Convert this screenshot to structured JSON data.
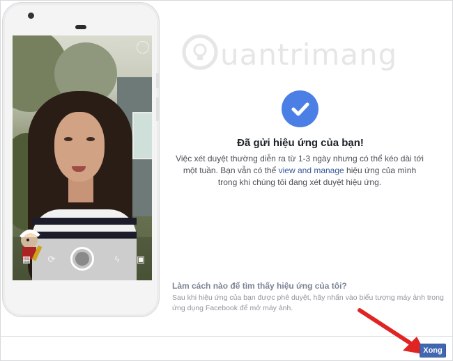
{
  "watermark": {
    "text": "uantrimang"
  },
  "dialog": {
    "title": "Đã gửi hiệu ứng của bạn!",
    "desc_part1": "Việc xét duyệt thường diễn ra từ 1-3 ngày nhưng có thể kéo dài tới một tuần. Bạn vẫn có thể ",
    "desc_link": "view and manage",
    "desc_part2": " hiệu ứng của mình trong khi chúng tôi đang xét duyệt hiệu ứng.",
    "help_question": "Làm cách nào để tìm thấy hiệu ứng của tôi?",
    "help_answer": "Sau khi hiệu ứng của bạn được phê duyệt, hãy nhấn vào biểu tượng máy ảnh trong ứng dụng Facebook để mở máy ảnh.",
    "done_button": "Xong"
  },
  "colors": {
    "accent": "#4267b2",
    "check_circle": "#4b7fe5",
    "link": "#365899",
    "arrow": "#e02424"
  },
  "icons": {
    "check": "check-icon",
    "camera_toolbar": [
      "image-stack-icon",
      "flip-camera-icon",
      "shutter-button",
      "flash-off-icon",
      "gallery-icon"
    ]
  }
}
